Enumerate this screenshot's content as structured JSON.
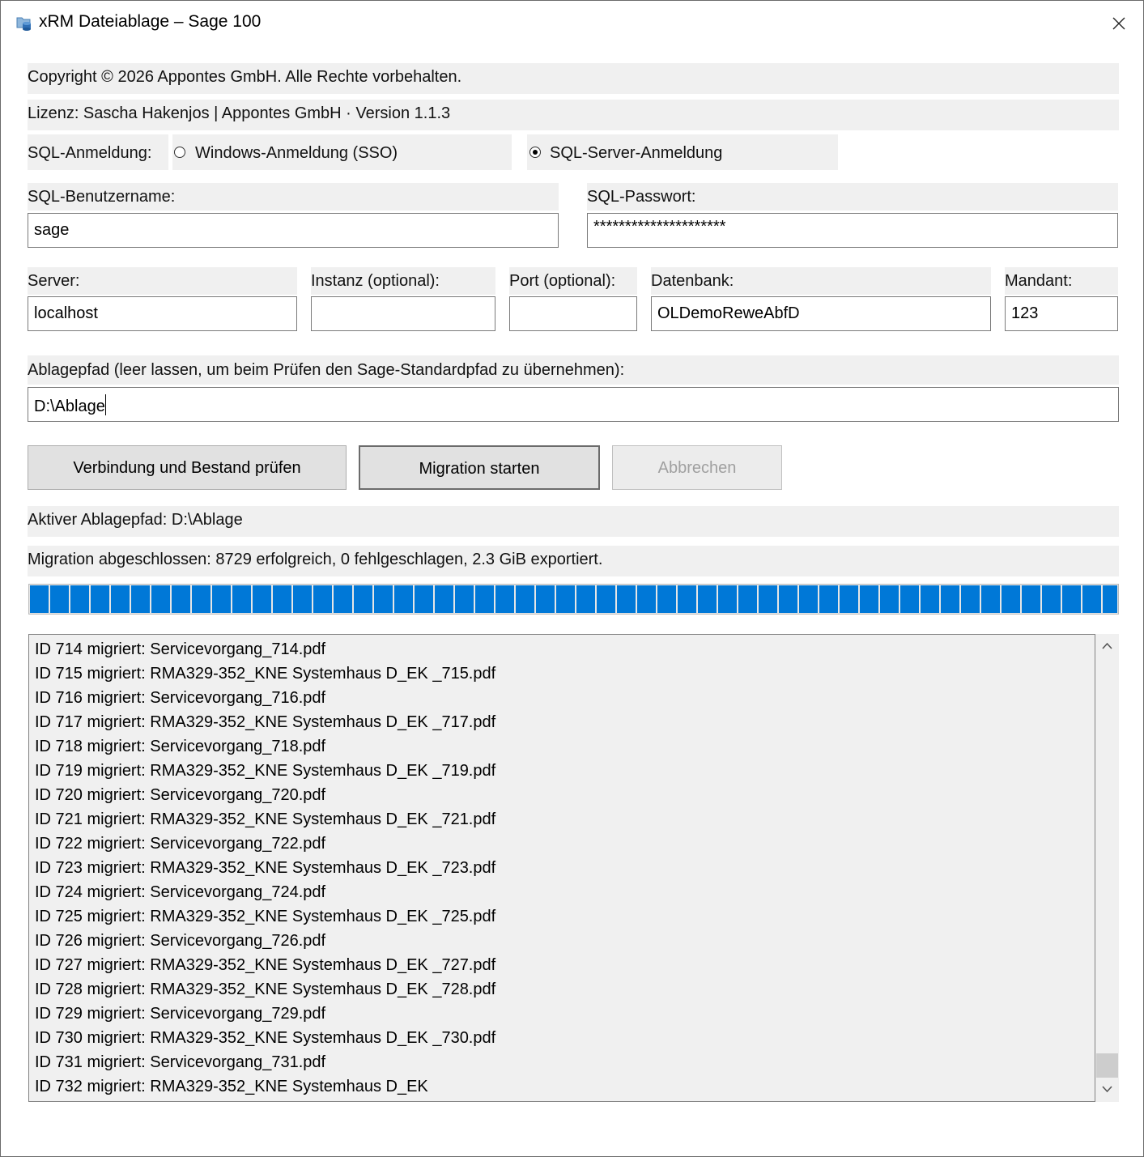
{
  "window": {
    "title": "xRM Dateiablage – Sage 100"
  },
  "info": {
    "copyright": "Copyright © 2026 Appontes GmbH. Alle Rechte vorbehalten.",
    "license": "Lizenz: Sascha Hakenjos | Appontes GmbH · Version 1.1.3"
  },
  "login": {
    "label": "SQL-Anmeldung:",
    "options": [
      {
        "label": "Windows-Anmeldung (SSO)",
        "selected": false
      },
      {
        "label": "SQL-Server-Anmeldung",
        "selected": true
      }
    ]
  },
  "credentials": {
    "username_label": "SQL-Benutzername:",
    "username_value": "sage",
    "password_label": "SQL-Passwort:",
    "password_value": "*********************"
  },
  "connection": {
    "server_label": "Server:",
    "server_value": "localhost",
    "instance_label": "Instanz (optional):",
    "instance_value": "",
    "port_label": "Port (optional):",
    "port_value": "",
    "database_label": "Datenbank:",
    "database_value": "OLDemoReweAbfD",
    "client_label": "Mandant:",
    "client_value": "123"
  },
  "storage": {
    "path_label": "Ablagepfad (leer lassen, um beim Prüfen den Sage-Standardpfad zu übernehmen):",
    "path_value": "D:\\Ablage"
  },
  "buttons": {
    "check": "Verbindung und Bestand prüfen",
    "start": "Migration starten",
    "cancel": "Abbrechen"
  },
  "status": {
    "active_path": "Aktiver Ablagepfad: D:\\Ablage",
    "result": "Migration abgeschlossen: 8729 erfolgreich, 0 fehlgeschlagen, 2.3 GiB exportiert.",
    "progress_fraction": 1.0,
    "progress_color": "#0078d7"
  },
  "log": {
    "lines": [
      "ID 714 migriert: Servicevorgang_714.pdf",
      "ID 715 migriert: RMA329-352_KNE Systemhaus D_EK _715.pdf",
      "ID 716 migriert: Servicevorgang_716.pdf",
      "ID 717 migriert: RMA329-352_KNE Systemhaus D_EK _717.pdf",
      "ID 718 migriert: Servicevorgang_718.pdf",
      "ID 719 migriert: RMA329-352_KNE Systemhaus D_EK _719.pdf",
      "ID 720 migriert: Servicevorgang_720.pdf",
      "ID 721 migriert: RMA329-352_KNE Systemhaus D_EK _721.pdf",
      "ID 722 migriert: Servicevorgang_722.pdf",
      "ID 723 migriert: RMA329-352_KNE Systemhaus D_EK _723.pdf",
      "ID 724 migriert: Servicevorgang_724.pdf",
      "ID 725 migriert: RMA329-352_KNE Systemhaus D_EK _725.pdf",
      "ID 726 migriert: Servicevorgang_726.pdf",
      "ID 727 migriert: RMA329-352_KNE Systemhaus D_EK _727.pdf",
      "ID 728 migriert: RMA329-352_KNE Systemhaus D_EK _728.pdf",
      "ID 729 migriert: Servicevorgang_729.pdf",
      "ID 730 migriert: RMA329-352_KNE Systemhaus D_EK _730.pdf",
      "ID 731 migriert: Servicevorgang_731.pdf",
      "ID 732 migriert: RMA329-352_KNE Systemhaus D_EK"
    ]
  },
  "icons": {
    "app": "database-folder-icon",
    "close": "close-icon",
    "scroll_up": "chevron-up-icon",
    "scroll_down": "chevron-down-icon"
  }
}
